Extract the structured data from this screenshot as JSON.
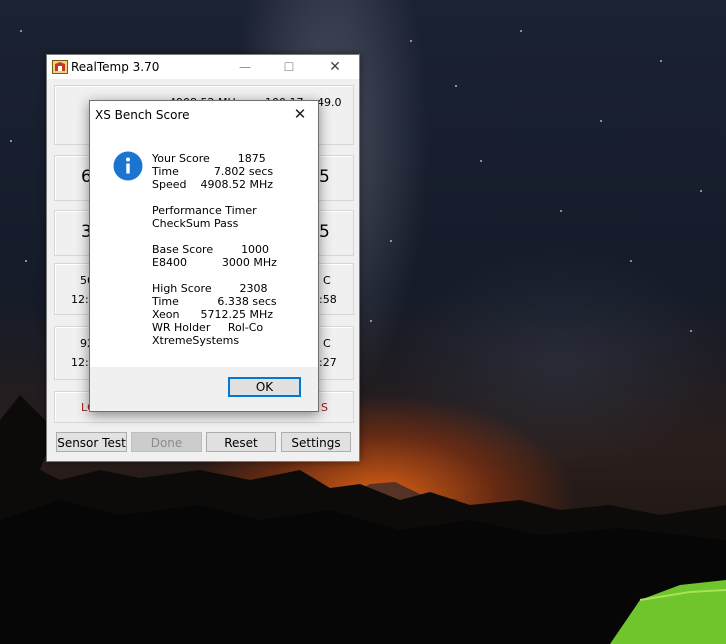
{
  "realtemp": {
    "title": "RealTemp 3.70",
    "controls": {
      "minimize": "—",
      "maximize": "☐",
      "close": "✕"
    },
    "fragments": {
      "row1_freq": "4908.52 MHz",
      "row1_multi": "100.17 x 49.0",
      "row2_left": "6",
      "row2_right": "5",
      "row3_left": "3",
      "row3_right": "5",
      "row4_left_top": "56",
      "row4_left_bottom": "12:1",
      "row4_right_top": "C",
      "row4_right_bottom": ":58",
      "row5_left_top": "92",
      "row5_left_bottom": "12:1",
      "row5_right_top": "C",
      "row5_right_bottom": ":27",
      "row6_left": "LC",
      "row6_right": "S"
    },
    "buttons": {
      "sensor_test": "Sensor Test",
      "done": "Done",
      "reset": "Reset",
      "settings": "Settings"
    }
  },
  "dialog": {
    "title": "XS Bench Score",
    "close": "✕",
    "icon": "info-icon",
    "lines": [
      "Your Score        1875",
      "Time          7.802 secs",
      "Speed    4908.52 MHz",
      "",
      "Performance Timer",
      "CheckSum Pass",
      "",
      "Base Score        1000",
      "E8400          3000 MHz",
      "",
      "High Score        2308",
      "Time           6.338 secs",
      "Xeon      5712.25 MHz",
      "WR Holder     Rol-Co",
      "XtremeSystems"
    ],
    "ok_label": "OK"
  },
  "colors": {
    "accent": "#0078d7",
    "info_icon": "#1a74d2",
    "window_bg": "#f0f0f0",
    "ember": "#ff6e14"
  }
}
